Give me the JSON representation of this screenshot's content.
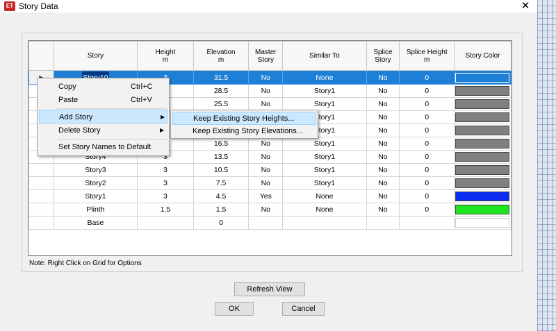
{
  "window": {
    "icon_text": "ET",
    "title": "Story Data",
    "close_glyph": "✕"
  },
  "table": {
    "headers": [
      {
        "line1": "",
        "line2": ""
      },
      {
        "line1": "Story",
        "line2": ""
      },
      {
        "line1": "Height",
        "line2": "m"
      },
      {
        "line1": "Elevation",
        "line2": "m"
      },
      {
        "line1": "Master",
        "line2": "Story"
      },
      {
        "line1": "Similar To",
        "line2": ""
      },
      {
        "line1": "Splice",
        "line2": "Story"
      },
      {
        "line1": "Splice Height",
        "line2": "m"
      },
      {
        "line1": "Story Color",
        "line2": ""
      }
    ],
    "rows": [
      {
        "story": "Story10",
        "height": "3",
        "elevation": "31.5",
        "master": "No",
        "similar": "None",
        "splice": "No",
        "splice_height": "0",
        "color": "#1e7fd6",
        "selected": true
      },
      {
        "story": "",
        "height": "",
        "elevation": "28.5",
        "master": "No",
        "similar": "Story1",
        "splice": "No",
        "splice_height": "0",
        "color": "#808080"
      },
      {
        "story": "",
        "height": "",
        "elevation": "25.5",
        "master": "No",
        "similar": "Story1",
        "splice": "No",
        "splice_height": "0",
        "color": "#808080"
      },
      {
        "story": "",
        "height": "",
        "elevation": "",
        "master": "",
        "similar": "Story1",
        "splice": "No",
        "splice_height": "0",
        "color": "#808080"
      },
      {
        "story": "",
        "height": "",
        "elevation": "",
        "master": "",
        "similar": "Story1",
        "splice": "No",
        "splice_height": "0",
        "color": "#808080"
      },
      {
        "story": "",
        "height": "",
        "elevation": "16.5",
        "master": "No",
        "similar": "Story1",
        "splice": "No",
        "splice_height": "0",
        "color": "#808080"
      },
      {
        "story": "Story4",
        "height": "3",
        "elevation": "13.5",
        "master": "No",
        "similar": "Story1",
        "splice": "No",
        "splice_height": "0",
        "color": "#808080"
      },
      {
        "story": "Story3",
        "height": "3",
        "elevation": "10.5",
        "master": "No",
        "similar": "Story1",
        "splice": "No",
        "splice_height": "0",
        "color": "#808080"
      },
      {
        "story": "Story2",
        "height": "3",
        "elevation": "7.5",
        "master": "No",
        "similar": "Story1",
        "splice": "No",
        "splice_height": "0",
        "color": "#808080"
      },
      {
        "story": "Story1",
        "height": "3",
        "elevation": "4.5",
        "master": "Yes",
        "similar": "None",
        "splice": "No",
        "splice_height": "0",
        "color": "#0a2cf0"
      },
      {
        "story": "Plinth",
        "height": "1.5",
        "elevation": "1.5",
        "master": "No",
        "similar": "None",
        "splice": "No",
        "splice_height": "0",
        "color": "#1ee61e"
      },
      {
        "story": "Base",
        "height": "",
        "elevation": "0",
        "master": "",
        "similar": "",
        "splice": "",
        "splice_height": "",
        "color": "#ffffff",
        "base": true
      }
    ]
  },
  "context_menu": {
    "copy": {
      "label": "Copy",
      "shortcut": "Ctrl+C"
    },
    "paste": {
      "label": "Paste",
      "shortcut": "Ctrl+V"
    },
    "add_story": {
      "label": "Add Story"
    },
    "delete_story": {
      "label": "Delete Story"
    },
    "set_names": {
      "label": "Set Story Names to Default"
    }
  },
  "submenu": {
    "keep_heights": "Keep Existing Story Heights...",
    "keep_elevations": "Keep Existing Story Elevations..."
  },
  "note": "Note:  Right Click on Grid for Options",
  "buttons": {
    "refresh": "Refresh View",
    "ok": "OK",
    "cancel": "Cancel"
  }
}
